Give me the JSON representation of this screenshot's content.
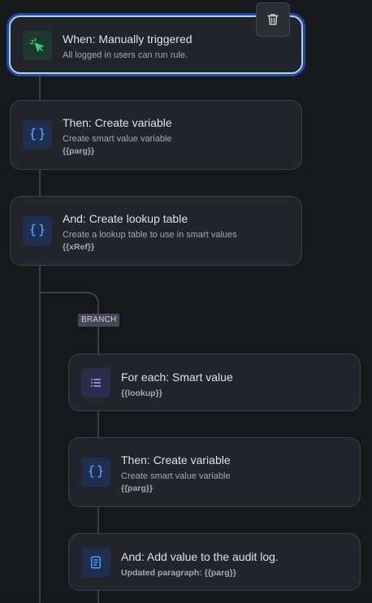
{
  "trigger": {
    "title": "When: Manually triggered",
    "description": "All logged in users can run rule.",
    "icon": "cursor-click-icon"
  },
  "delete_button": {
    "icon": "trash-icon"
  },
  "steps": [
    {
      "title": "Then: Create variable",
      "description": "Create smart value variable",
      "code": "{{parg}}",
      "icon": "braces-icon"
    },
    {
      "title": "And: Create lookup table",
      "description": "Create a lookup table to use in smart values",
      "code": "{{xRef}}",
      "icon": "braces-icon"
    }
  ],
  "branch": {
    "label": "BRANCH",
    "steps": [
      {
        "title": "For each: Smart value",
        "code": "{{lookup}}",
        "icon": "list-icon"
      },
      {
        "title": "Then: Create variable",
        "description": "Create smart value variable",
        "code": "{{parg}}",
        "icon": "braces-icon"
      },
      {
        "title": "And: Add value to the audit log.",
        "code": "Updated paragraph: {{parg}}",
        "icon": "document-icon"
      }
    ]
  },
  "colors": {
    "background": "#17181c",
    "card": "#22252a",
    "selection_border": "#b8cdf3",
    "selection_glow": "#1e4da8",
    "icon_blue": "#4c9aff",
    "icon_green": "#2ecb7c",
    "icon_purple": "#9f8fef"
  }
}
